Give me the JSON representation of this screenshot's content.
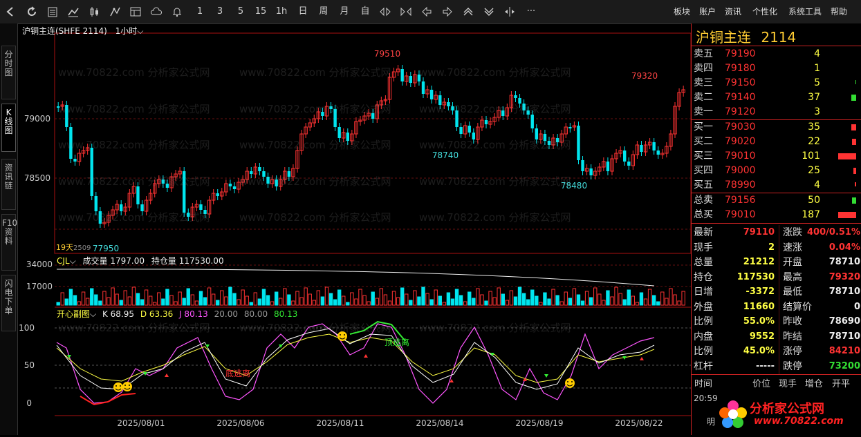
{
  "toolbar": {
    "periods": [
      "1",
      "3",
      "5",
      "15",
      "1h",
      "日",
      "周",
      "月",
      "自"
    ],
    "menus": [
      "板块",
      "账户",
      "资讯",
      "个性化",
      "系统工具",
      "帮助"
    ],
    "more": "···"
  },
  "left_tabs": [
    "分时图",
    "K线图",
    "资讯链",
    "F10资料",
    "闪电下单"
  ],
  "header": {
    "contract": "沪铜主连(SHFE 2114)",
    "period": "1小时",
    "dropdown": "⌵"
  },
  "price_axis": [
    "79000",
    "78500"
  ],
  "volume_axis": [
    "34000",
    "17000"
  ],
  "kdj_axis": [
    "100",
    "50",
    "0"
  ],
  "annotations": {
    "high1": "79510",
    "high2": "79320",
    "low1": "78740",
    "low2": "78480",
    "low3": "77950",
    "contract_tag": "19天",
    "contract_code": "2509"
  },
  "volume_header": {
    "name": "CJL",
    "vol_label": "成交量",
    "vol_value": "1797.00",
    "oi_label": "持仓量",
    "oi_value": "117530.00"
  },
  "indicator_header": {
    "name": "开心副图",
    "k": "K 68.95",
    "d": "D 63.36",
    "j": "J 80.13",
    "v20": "20.00",
    "v80": "80.00",
    "v8013": "80.13"
  },
  "indicator_labels": {
    "top": "顶逃离",
    "bottom": "底逃离"
  },
  "x_dates": [
    "2025/08/01",
    "2025/08/06",
    "2025/08/11",
    "2025/08/14",
    "2025/08/19",
    "2025/08/22"
  ],
  "watermark": "www.70822.com 分析家公式网",
  "quote": {
    "title": "沪铜主连",
    "code": "2114",
    "asks": [
      {
        "label": "卖五",
        "price": "79190",
        "vol": "4"
      },
      {
        "label": "卖四",
        "price": "79180",
        "vol": "1"
      },
      {
        "label": "卖三",
        "price": "79150",
        "vol": "5"
      },
      {
        "label": "卖二",
        "price": "79140",
        "vol": "37"
      },
      {
        "label": "卖一",
        "price": "79120",
        "vol": "3"
      }
    ],
    "bids": [
      {
        "label": "买一",
        "price": "79030",
        "vol": "35"
      },
      {
        "label": "买二",
        "price": "79020",
        "vol": "22"
      },
      {
        "label": "买三",
        "price": "79010",
        "vol": "101"
      },
      {
        "label": "买四",
        "price": "79000",
        "vol": "25"
      },
      {
        "label": "买五",
        "price": "78990",
        "vol": "4"
      }
    ],
    "totals": [
      {
        "label": "总卖",
        "price": "79156",
        "vol": "50"
      },
      {
        "label": "总买",
        "price": "79010",
        "vol": "187"
      }
    ],
    "stats_left": [
      {
        "label": "最新",
        "value": "79110",
        "c": "red"
      },
      {
        "label": "现手",
        "value": "2",
        "c": "yel"
      },
      {
        "label": "总量",
        "value": "21212",
        "c": "yel"
      },
      {
        "label": "持仓",
        "value": "117530",
        "c": "yel"
      },
      {
        "label": "日增",
        "value": "-3372",
        "c": "yel"
      },
      {
        "label": "外盘",
        "value": "11660",
        "c": "yel"
      },
      {
        "label": "比例",
        "value": "55.0%",
        "c": "yel"
      },
      {
        "label": "内盘",
        "value": "9552",
        "c": "yel"
      },
      {
        "label": "比例",
        "value": "45.0%",
        "c": "yel"
      },
      {
        "label": "杠杆",
        "value": "-----",
        "c": "wht"
      }
    ],
    "stats_right": [
      {
        "label": "涨跌",
        "value": "400/0.51%",
        "c": "red"
      },
      {
        "label": "速涨",
        "value": "0.04%",
        "c": "red"
      },
      {
        "label": "开盘",
        "value": "78710",
        "c": "wht"
      },
      {
        "label": "最高",
        "value": "79320",
        "c": "red"
      },
      {
        "label": "最低",
        "value": "78710",
        "c": "wht"
      },
      {
        "label": "结算价",
        "value": "0",
        "c": "wht"
      },
      {
        "label": "昨收",
        "value": "78690",
        "c": "wht"
      },
      {
        "label": "昨结",
        "value": "78710",
        "c": "wht"
      },
      {
        "label": "涨停",
        "value": "84210",
        "c": "red"
      },
      {
        "label": "跌停",
        "value": "73200",
        "c": "grn"
      }
    ],
    "tick_headers": [
      "时间",
      "价位",
      "现手",
      "增仓",
      "开平"
    ],
    "tick_time": "20:59",
    "side_tab": "明"
  },
  "logo": {
    "name": "分析家公式网",
    "url": "www.70822.com"
  }
}
